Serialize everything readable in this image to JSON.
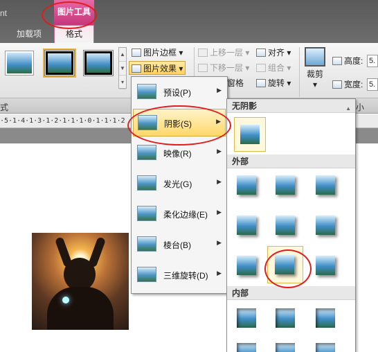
{
  "tabs": {
    "partial": "nt",
    "context_header": "图片工具",
    "addins": "加载项",
    "format": "格式"
  },
  "ribbon": {
    "picture_border": "图片边框",
    "picture_effects": "图片效果",
    "bring_forward": "上移一层",
    "send_backward": "下移一层",
    "selection_pane": "窗格",
    "align": "对齐",
    "group": "组合",
    "rotate": "旋转",
    "crop": "裁剪",
    "height_label": "高度:",
    "width_label": "宽度:",
    "height_value": "5.",
    "width_value": "5.",
    "footer_left": "式",
    "footer_right": "小"
  },
  "ruler": {
    "text": "·5·1·4·1·3·1·2·1·1·1·0·1·1·1·2"
  },
  "menu": {
    "items": [
      {
        "label": "预设(P)"
      },
      {
        "label": "阴影(S)"
      },
      {
        "label": "映像(R)"
      },
      {
        "label": "发光(G)"
      },
      {
        "label": "柔化边缘(E)"
      },
      {
        "label": "棱台(B)"
      },
      {
        "label": "三维旋转(D)"
      }
    ]
  },
  "submenu": {
    "no_shadow": "无阴影",
    "outer": "外部",
    "inner": "内部"
  },
  "icons": {
    "submenu_arrow": "▶",
    "dropdown_arrow": "▾",
    "scroll_up": "▲"
  },
  "colors": {
    "accent_context_tab": "#c6327a",
    "highlight": "#ffd86a",
    "annotation": "#e21b1b"
  }
}
